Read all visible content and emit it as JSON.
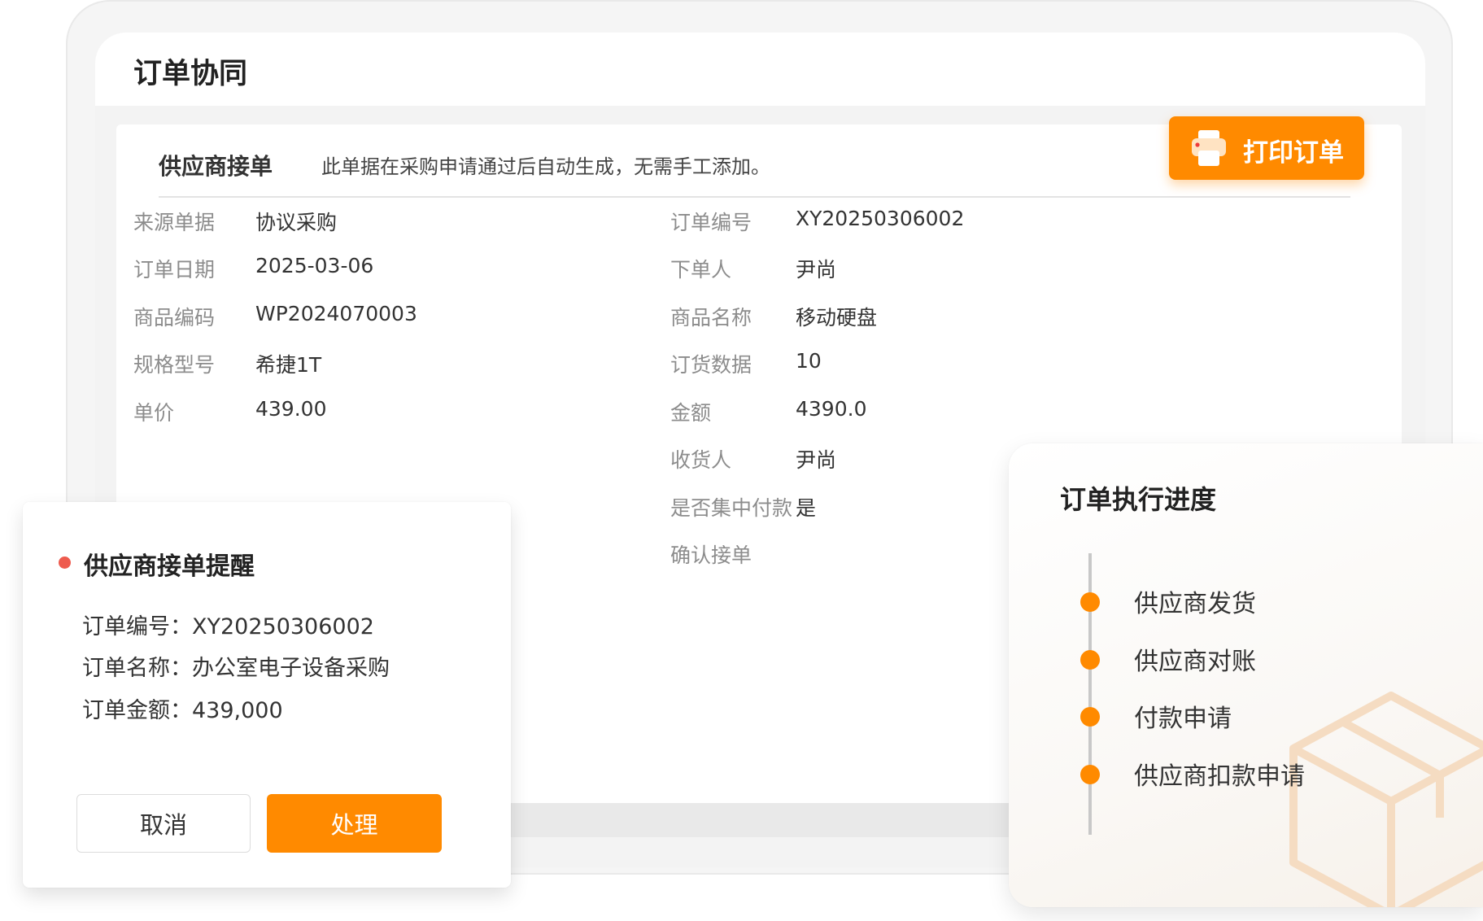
{
  "window": {
    "title": "订单协同"
  },
  "card": {
    "title": "供应商接单",
    "description": "此单据在采购申请通过后自动生成，无需手工添加。"
  },
  "print_button": {
    "label": "打印订单",
    "icon": "printer-icon"
  },
  "fields_left": [
    {
      "label": "来源单据",
      "value": "协议采购"
    },
    {
      "label": "订单日期",
      "value": "2025-03-06"
    },
    {
      "label": "商品编码",
      "value": "WP2024070003"
    },
    {
      "label": "规格型号",
      "value": "希捷1T"
    },
    {
      "label": "单价",
      "value": "439.00"
    }
  ],
  "fields_right": [
    {
      "label": "订单编号",
      "value": "XY20250306002"
    },
    {
      "label": "下单人",
      "value": "尹尚"
    },
    {
      "label": "商品名称",
      "value": "移动硬盘"
    },
    {
      "label": "订货数据",
      "value": "10"
    },
    {
      "label": "金额",
      "value": "4390.0"
    },
    {
      "label": "收货人",
      "value": "尹尚"
    },
    {
      "label": "是否集中付款",
      "value": "是"
    },
    {
      "label": "确认接单",
      "value": ""
    }
  ],
  "popup": {
    "title": "供应商接单提醒",
    "lines": [
      "订单编号：XY20250306002",
      "订单名称：办公室电子设备采购",
      "订单金额：439,000"
    ],
    "cancel_label": "取消",
    "process_label": "处理"
  },
  "progress": {
    "title": "订单执行进度",
    "steps": [
      "供应商发货",
      "供应商对账",
      "付款申请",
      "供应商扣款申请"
    ]
  },
  "colors": {
    "accent": "#ff8a00",
    "alert_dot": "#ee5b4e",
    "label_gray": "#8c8c8c"
  }
}
